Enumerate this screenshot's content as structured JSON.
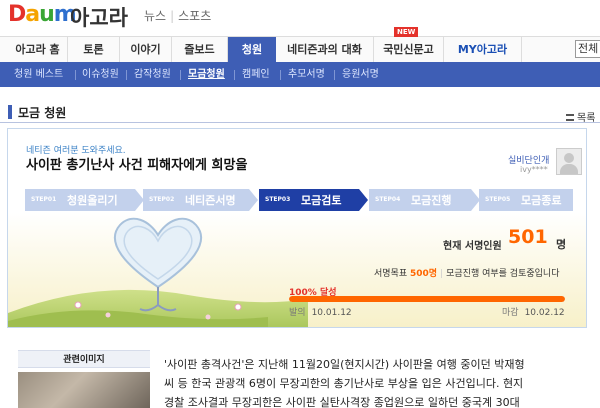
{
  "brand": {
    "logo_text": [
      "D",
      "a",
      "u",
      "m"
    ],
    "app_name": "아고라",
    "colors": {
      "primary": "#3e5eb5",
      "accent": "#ff6600",
      "badge": "#e4322b"
    }
  },
  "quick_links": [
    "뉴스",
    "스포츠"
  ],
  "nav": {
    "items": [
      "아고라 홈",
      "토론",
      "이야기",
      "즐보드",
      "청원",
      "네티즌과의 대화",
      "국민신문고",
      "MY아고라"
    ],
    "active": "청원",
    "new_badge": "NEW",
    "search_placeholder": "전체"
  },
  "subnav": {
    "items": [
      "청원 베스트",
      "이슈청원",
      "감작청원",
      "모금청원",
      "캠페인",
      "추모서명",
      "응원서명"
    ],
    "active": "모금청원"
  },
  "section": {
    "title": "모금 청원",
    "list_link": "목록"
  },
  "petition": {
    "tagline": "네티즌 여러분 도와주세요.",
    "title": "사이판 총기난사 사건 피해자에게 희망을",
    "author": "실비단인개",
    "author_id": "ivy****",
    "steps": [
      {
        "num": "STEP01",
        "label": "청원올리기"
      },
      {
        "num": "STEP02",
        "label": "네티즌서명"
      },
      {
        "num": "STEP03",
        "label": "모금검토"
      },
      {
        "num": "STEP04",
        "label": "모금진행"
      },
      {
        "num": "STEP05",
        "label": "모금종료"
      }
    ],
    "current_step": 3,
    "stats": {
      "signers_label": "현재 서명인원",
      "signers_value": "501",
      "signers_unit": "명",
      "goal_label": "서명목표",
      "goal_value": "500명",
      "goal_sep": "|",
      "goal_status": "모금진행 여부를 검토중입니다",
      "progress_label": "100% 달성",
      "progress_percent": 100,
      "start_label": "발의",
      "start_date": "10.01.12",
      "end_label": "마감",
      "end_date": "10.02.12"
    }
  },
  "related": {
    "title": "관련이미지"
  },
  "article": {
    "lines": [
      "'사이판 총격사건'은 지난해 11월20일(현지시간) 사이판을 여행 중이던 박재형",
      "씨 등 한국 관광객 6명이 무장괴한의 총기난사로 부상을 입은 사건입니다. 현지",
      "경찰 조사결과 무장괴한은 사이판 실탄사격장 종업원으로 일하던 중국계 30대"
    ]
  }
}
